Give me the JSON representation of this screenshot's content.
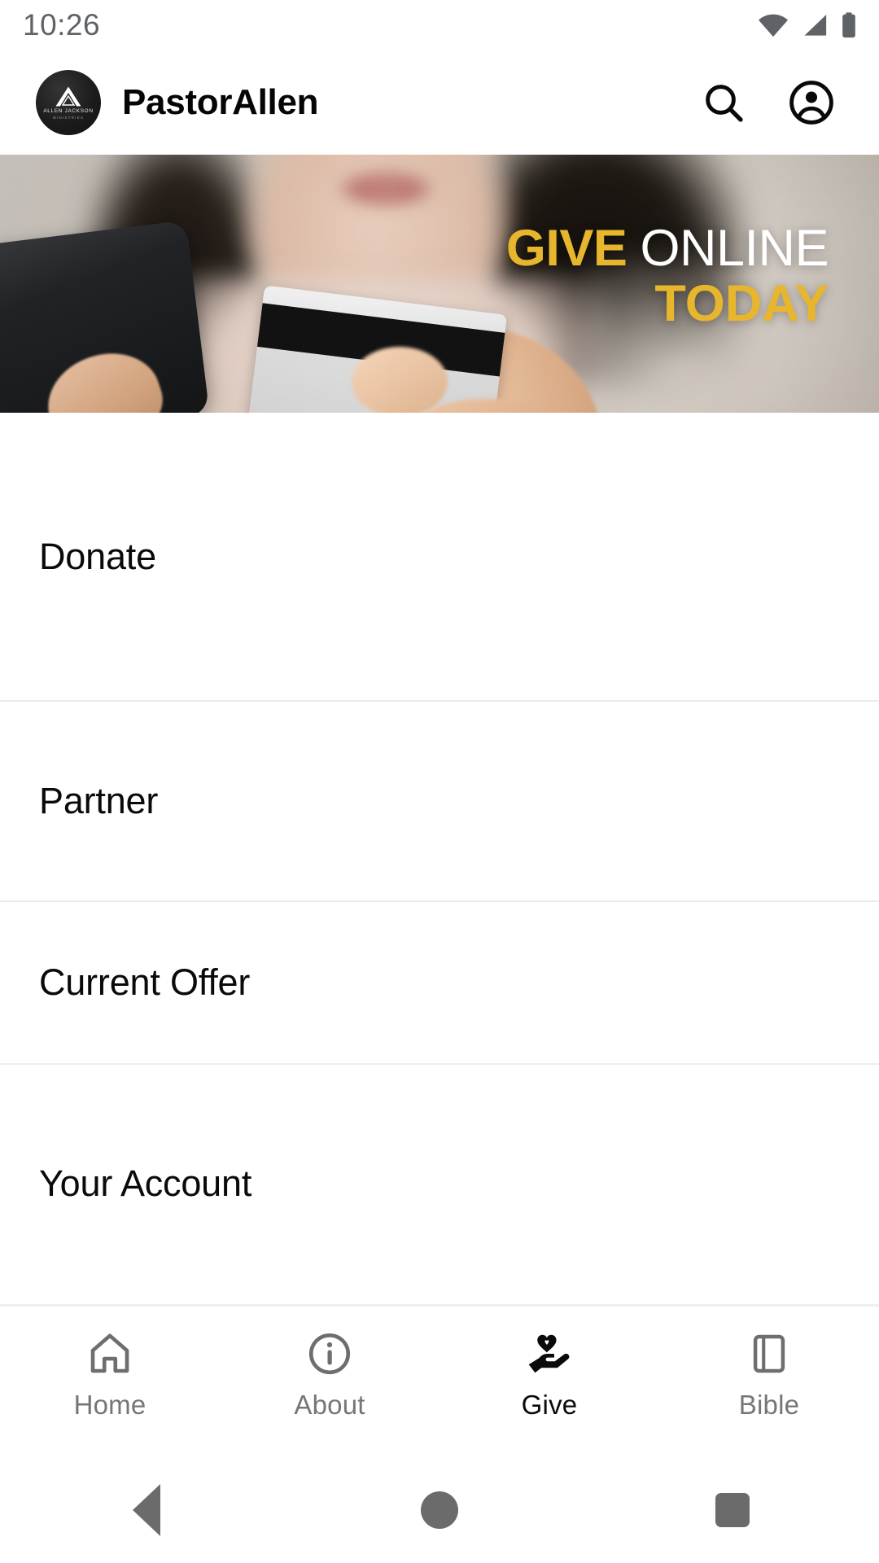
{
  "status_bar": {
    "time": "10:26",
    "icons": [
      "wifi-icon",
      "cellular-signal-icon",
      "battery-icon"
    ]
  },
  "header": {
    "logo": {
      "icon": "allen-jackson-ministries-logo",
      "line1": "ALLEN JACKSON",
      "line2": "MINISTRIES"
    },
    "title": "PastorAllen",
    "actions": [
      {
        "name": "search-icon",
        "label": "Search"
      },
      {
        "name": "account-circle-icon",
        "label": "Account"
      }
    ]
  },
  "hero": {
    "alt": "Woman holding a phone and a credit card",
    "line1_word1": "GIVE",
    "line1_word2": "ONLINE",
    "line2": "TODAY",
    "accent_color": "#e8b62c",
    "white_color": "#ffffff"
  },
  "menu": {
    "items": [
      {
        "label": "Donate"
      },
      {
        "label": "Partner"
      },
      {
        "label": "Current Offer"
      },
      {
        "label": "Your Account"
      }
    ]
  },
  "bottom_nav": {
    "active_index": 2,
    "active_color": "#0a0a0a",
    "inactive_color": "#767676",
    "items": [
      {
        "label": "Home",
        "icon": "home-icon"
      },
      {
        "label": "About",
        "icon": "info-circle-icon"
      },
      {
        "label": "Give",
        "icon": "volunteer-hand-heart-icon"
      },
      {
        "label": "Bible",
        "icon": "book-icon"
      }
    ]
  },
  "system_nav": {
    "items": [
      {
        "name": "system-back-button",
        "label": "Back"
      },
      {
        "name": "system-home-button",
        "label": "Home"
      },
      {
        "name": "system-recents-button",
        "label": "Recents"
      }
    ]
  }
}
